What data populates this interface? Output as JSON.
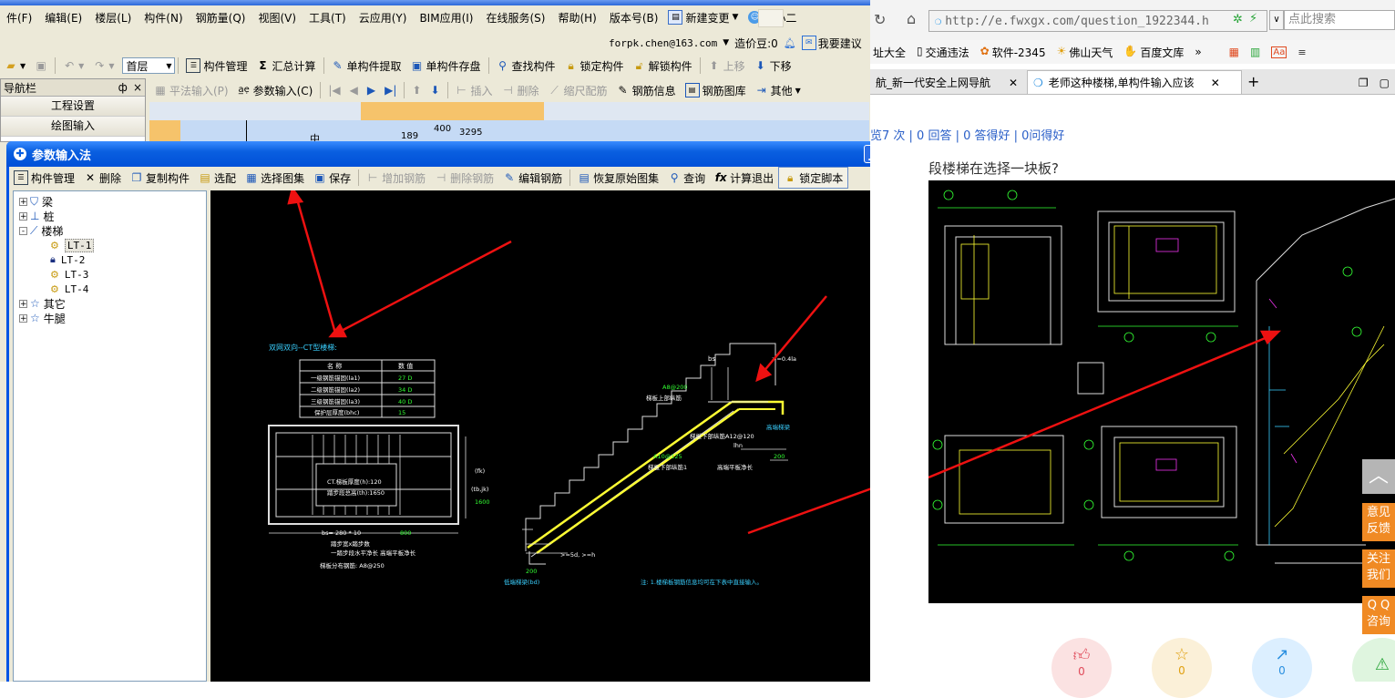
{
  "app": {
    "menu": [
      "件(F)",
      "编辑(E)",
      "楼层(L)",
      "构件(N)",
      "钢筋量(Q)",
      "视图(V)",
      "工具(T)",
      "云应用(Y)",
      "BIM应用(I)",
      "在线服务(S)",
      "帮助(H)",
      "版本号(B)",
      "新建变更",
      "广小二"
    ],
    "account": "forpk.chen@163.com",
    "price_bean": "造价豆:0",
    "suggest": "我要建议",
    "floor": "首层",
    "toolbar1": {
      "component_mgmt": "构件管理",
      "sum_calc": "汇总计算",
      "single_extract": "单构件提取",
      "single_save": "单构件存盘",
      "find": "查找构件",
      "lock": "锁定构件",
      "unlock": "解锁构件",
      "move_up": "上移",
      "move_down": "下移"
    },
    "toolbar2": {
      "plane_input": "平法输入(P)",
      "param_input": "参数输入(C)",
      "insert": "插入",
      "delete": "删除",
      "scale": "缩尺配筋",
      "rebar_info": "钢筋信息",
      "rebar_atlas": "钢筋图库",
      "other": "其他"
    },
    "nav": {
      "title": "导航栏",
      "pin": "ф",
      "close": "×",
      "items": [
        "工程设置",
        "绘图输入"
      ]
    },
    "grid": {
      "c1": "中",
      "c2": "189",
      "c3": "400",
      "c4": "3295"
    }
  },
  "dialog": {
    "title": "参数输入法",
    "toolbar": {
      "component_mgmt": "构件管理",
      "delete": "删除",
      "copy": "复制构件",
      "select": "选配",
      "select_atlas": "选择图集",
      "save": "保存",
      "add_rebar": "增加钢筋",
      "del_rebar": "删除钢筋",
      "edit_rebar": "编辑钢筋",
      "restore": "恢复原始图集",
      "query": "查询",
      "calc_exit": "计算退出",
      "lock_script": "锁定脚本"
    },
    "tree": [
      {
        "label": "梁",
        "level": 0,
        "toggle": "+"
      },
      {
        "label": "桩",
        "level": 0,
        "toggle": "+"
      },
      {
        "label": "楼梯",
        "level": 0,
        "toggle": "-"
      },
      {
        "label": "LT-1",
        "level": 1
      },
      {
        "label": "LT-2",
        "level": 1
      },
      {
        "label": "LT-3",
        "level": 1
      },
      {
        "label": "LT-4",
        "level": 1
      },
      {
        "label": "其它",
        "level": 0,
        "toggle": "+"
      },
      {
        "label": "牛腿",
        "level": 0,
        "toggle": "+"
      }
    ],
    "drawing": {
      "title": "双网双向--CT型楼梯:",
      "table_head": [
        "名  称",
        "数  值"
      ],
      "table_rows": [
        [
          "一级钢筋锚固(la1)",
          "27 D"
        ],
        [
          "二级钢筋锚固(la2)",
          "34 D"
        ],
        [
          "三级钢筋锚固(la3)",
          "40 D"
        ],
        [
          "保护层厚度(bhc)",
          "15"
        ]
      ],
      "plan_text1": "CT.梯板厚度(h):120",
      "plan_text2": "踏步段总高(th):1650",
      "dim_right1": "(fk)",
      "dim_right2": "(tb,jk)",
      "dim_right3": "1600",
      "bottom1": "bs= 280 * 10",
      "bottom2": "800",
      "bottom3": "踏步宽x踏步数",
      "bottom4": "一踏步段水平净长 高端平板净长",
      "bottom5": "梯板分布钢筋: A8@250",
      "s_top": "梯板上部纵筋",
      "s_a8": "A8@200",
      "s_bs": "bs",
      "s_04la": ">=0.4la",
      "s_high": "高端梯梁",
      "s_bottom_rebar": "梯板下部纵筋A12@120",
      "s_a10": "A10@125",
      "s_bot1": "梯板下部纵筋1",
      "s_hp": "高端平板净长",
      "s_200a": "200",
      "s_200b": "200",
      "s_low": "低端梯梁(bd)",
      "s_5d": ">=5d, >=h",
      "s_hn": "lhn",
      "note": "注: 1.楼梯板钢筋信息均可在下表中直接输入。"
    }
  },
  "browser": {
    "url": "http://e.fwxgx.com/question_1922344.h",
    "search_placeholder": "点此搜索",
    "bookmarks": [
      "址大全",
      "交通违法",
      "软件-2345",
      "佛山天气",
      "百度文库"
    ],
    "tabs": [
      "航_新一代安全上网导航",
      "老师这种楼梯,单构件输入应该"
    ],
    "stats": "览7 次 | 0 回答 | 0 答得好 | 0问得好",
    "question": "段楼梯在选择一块板?",
    "side_feedback": "意见\n反馈",
    "side_follow": "关注\n我们",
    "side_qq": "Q Q\n咨询",
    "count1": "0",
    "count2": "0",
    "count3": "0"
  }
}
